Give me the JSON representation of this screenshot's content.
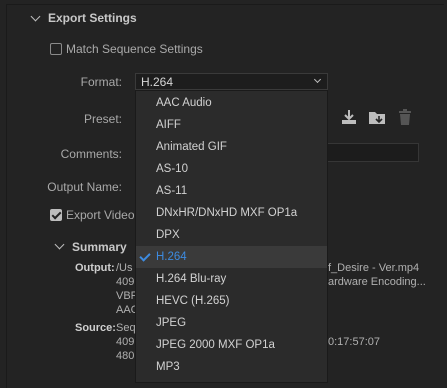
{
  "export_settings": {
    "title": "Export Settings",
    "match_sequence_label": "Match Sequence Settings",
    "match_sequence_checked": false,
    "format_label": "Format:",
    "format_value": "H.264",
    "preset_label": "Preset:",
    "comments_label": "Comments:",
    "output_name_label": "Output Name:",
    "export_video_label": "Export Video",
    "export_video_checked": true
  },
  "summary": {
    "title": "Summary",
    "output_key": "Output:",
    "output_lines": [
      "/Us",
      "409",
      "VBF",
      "AAC"
    ],
    "output_right_1": "f_Desire - Ver.mp4",
    "output_right_2": "ardware Encoding...",
    "source_key": "Source:",
    "source_lines": [
      "Seq",
      "409",
      "480"
    ],
    "source_right_1": "0:17:57:07"
  },
  "format_dropdown": {
    "items": [
      "AAC Audio",
      "AIFF",
      "Animated GIF",
      "AS-10",
      "AS-11",
      "DNxHR/DNxHD MXF OP1a",
      "DPX",
      "H.264",
      "H.264 Blu-ray",
      "HEVC (H.265)",
      "JPEG",
      "JPEG 2000 MXF OP1a",
      "MP3"
    ],
    "selected": "H.264"
  },
  "preset_icons": [
    "import-preset-icon",
    "save-preset-icon",
    "delete-preset-icon"
  ],
  "colors": {
    "accent": "#3d8be0",
    "background": "#232323"
  }
}
